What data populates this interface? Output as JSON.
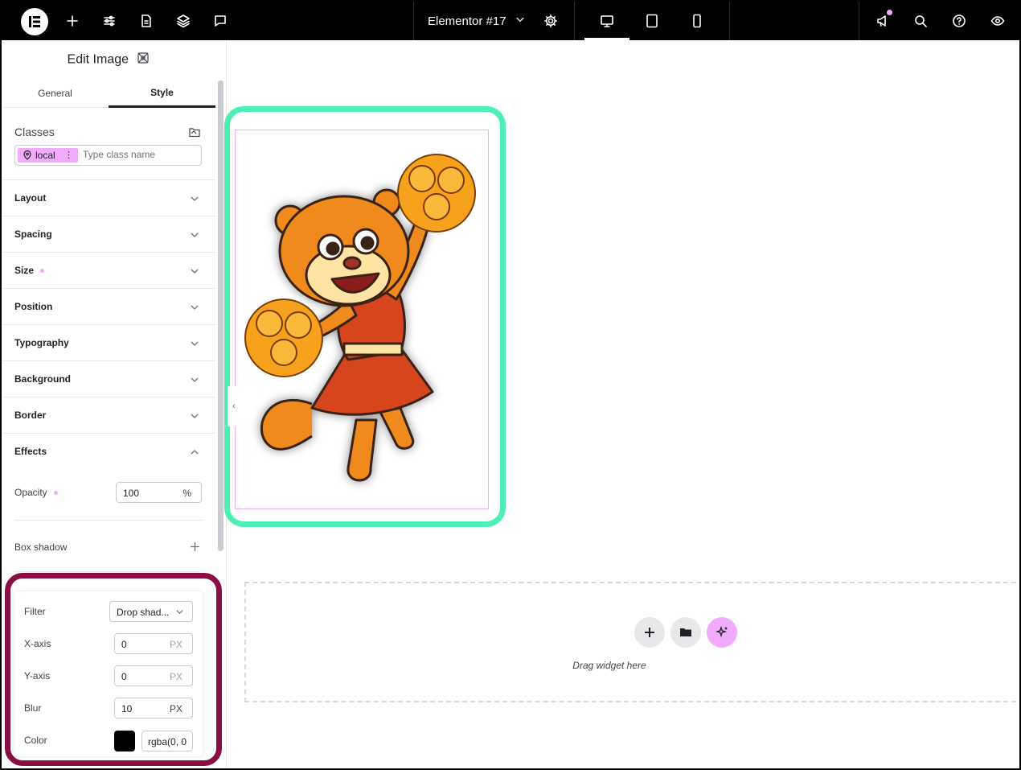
{
  "topbar": {
    "document_title": "Elementor #17",
    "icons": [
      "elementor-logo",
      "add-icon",
      "sliders-icon",
      "page-icon",
      "layers-icon",
      "comment-icon",
      "chevron-down-icon",
      "gear-icon",
      "desktop-icon",
      "tablet-icon",
      "mobile-icon",
      "megaphone-icon",
      "search-icon",
      "help-icon",
      "eye-icon"
    ]
  },
  "panel": {
    "title": "Edit Image",
    "tabs": [
      "General",
      "Style"
    ],
    "classes": {
      "label": "Classes",
      "chip": "local",
      "placeholder": "Type class name"
    },
    "sections": [
      "Layout",
      "Spacing",
      "Size",
      "Position",
      "Typography",
      "Background",
      "Border",
      "Effects"
    ],
    "effects": {
      "opacity_label": "Opacity",
      "opacity_value": "100",
      "opacity_unit": "%",
      "box_shadow_label": "Box shadow",
      "filter": {
        "filter_label": "Filter",
        "filter_value": "Drop shad...",
        "x_label": "X-axis",
        "x_value": "0",
        "x_unit": "PX",
        "y_label": "Y-axis",
        "y_value": "0",
        "y_unit": "PX",
        "blur_label": "Blur",
        "blur_value": "10",
        "blur_unit": "PX",
        "color_label": "Color",
        "color_swatch": "#000000",
        "color_value": "rgba(0, 0"
      }
    }
  },
  "canvas": {
    "dropzone_text": "Drag widget here"
  },
  "colors": {
    "accent_pink": "#f0abfc",
    "highlight_green": "#4eefb5",
    "highlight_maroon": "#8a0f47"
  }
}
